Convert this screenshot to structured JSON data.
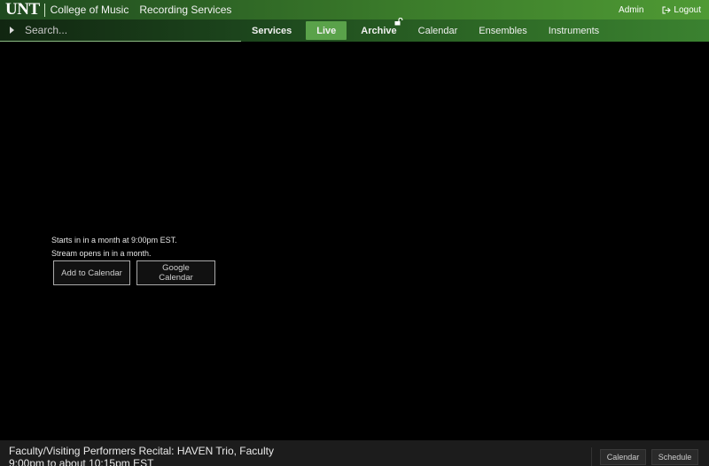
{
  "header": {
    "logo": "UNT",
    "college": "College of Music",
    "department": "Recording Services",
    "admin": "Admin",
    "logout": "Logout"
  },
  "nav": {
    "search_placeholder": "Search...",
    "items": [
      "Services",
      "Live",
      "Archive",
      "Calendar",
      "Ensembles",
      "Instruments"
    ],
    "active": "Live"
  },
  "player": {
    "starts": "Starts in in a month at 9:00pm EST.",
    "stream_opens": "Stream opens in in a month.",
    "add_to_calendar": "Add to Calendar",
    "google_calendar": "Google Calendar"
  },
  "footer": {
    "event_title": "Faculty/Visiting Performers Recital: HAVEN Trio, Faculty",
    "event_time": "9:00pm to about 10:15pm EST",
    "calendar_button": "Calendar",
    "schedule_button": "Schedule"
  },
  "colors": {
    "active_tab": "#5aa24a",
    "header_green": "#3a7a2a",
    "background": "#000000"
  }
}
